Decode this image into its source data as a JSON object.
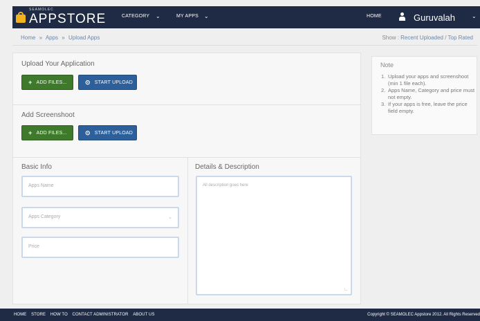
{
  "navbar": {
    "brand_small": "SEAMOLEC",
    "brand_big": "APPSTORE",
    "items": [
      {
        "label": "CATEGORY"
      },
      {
        "label": "MY APPS"
      }
    ],
    "home": "HOME",
    "user": "Guruvalah",
    "icons": {
      "logo": "shopping-bag-icon",
      "user": "user-icon",
      "caret": "chevron-down-icon"
    },
    "bg_color": "#1f2a44"
  },
  "breadcrumb": {
    "items": [
      "Home",
      "»",
      "Apps",
      "»",
      "Upload Apps"
    ],
    "show_label": "Show :",
    "recent": "Recent Uploaded",
    "separator": "/",
    "top": "Top Rated"
  },
  "upload_app": {
    "title": "Upload Your Application",
    "add_files": "ADD FILES...",
    "start_upload": "START UPLOAD"
  },
  "screenshot": {
    "title": "Add Screenshoot",
    "add_files": "ADD FILES...",
    "start_upload": "START UPLOAD"
  },
  "basic_info": {
    "title": "Basic Info",
    "app_name_placeholder": "Apps Name",
    "category_value": "Apps Category",
    "price_placeholder": "Price"
  },
  "details": {
    "title": "Details & Description",
    "placeholder": "All description goes here"
  },
  "note": {
    "title": "Note",
    "items": [
      {
        "num": "1.",
        "text": "Upload your apps and screenshoot (min 1 file each)."
      },
      {
        "num": "2.",
        "text": "Apps Name, Category and price must not empty."
      },
      {
        "num": "3.",
        "text": "If your apps is free, leave the price field empty."
      }
    ]
  },
  "footer": {
    "links": [
      "HOME",
      "STORE",
      "HOW TO",
      "CONTACT ADMINISTRATOR",
      "ABOUT US"
    ],
    "copyright": "Copyright © SEAMOLEC Appstore 2012. All Rights Reserved"
  },
  "colors": {
    "green": "#3f7a2c",
    "blue": "#2d5f9a",
    "link": "#6b86a8"
  }
}
